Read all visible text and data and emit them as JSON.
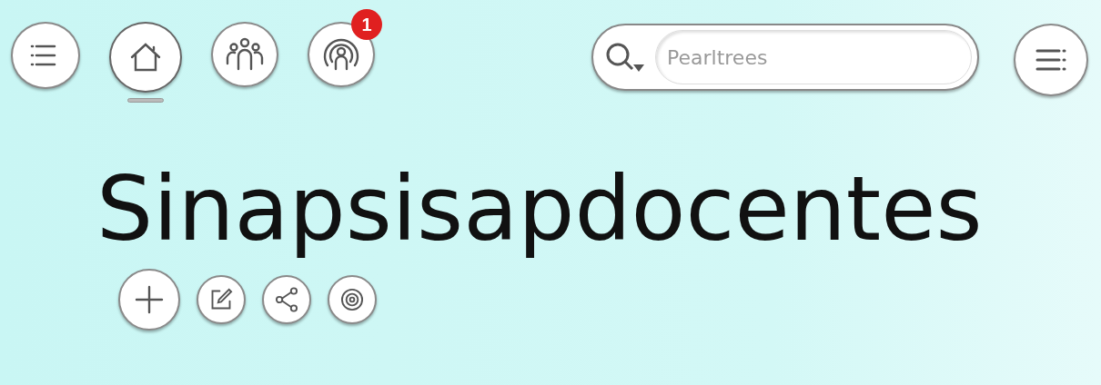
{
  "nav": [
    {
      "kind": "list",
      "selected": false
    },
    {
      "kind": "home",
      "selected": true
    },
    {
      "kind": "team",
      "selected": false
    },
    {
      "kind": "feed",
      "selected": false,
      "badge": "1"
    }
  ],
  "search": {
    "placeholder": "Pearltrees"
  },
  "title": "Sinapsisapdocentes",
  "actions": [
    {
      "kind": "add"
    },
    {
      "kind": "edit"
    },
    {
      "kind": "share"
    },
    {
      "kind": "target"
    }
  ]
}
